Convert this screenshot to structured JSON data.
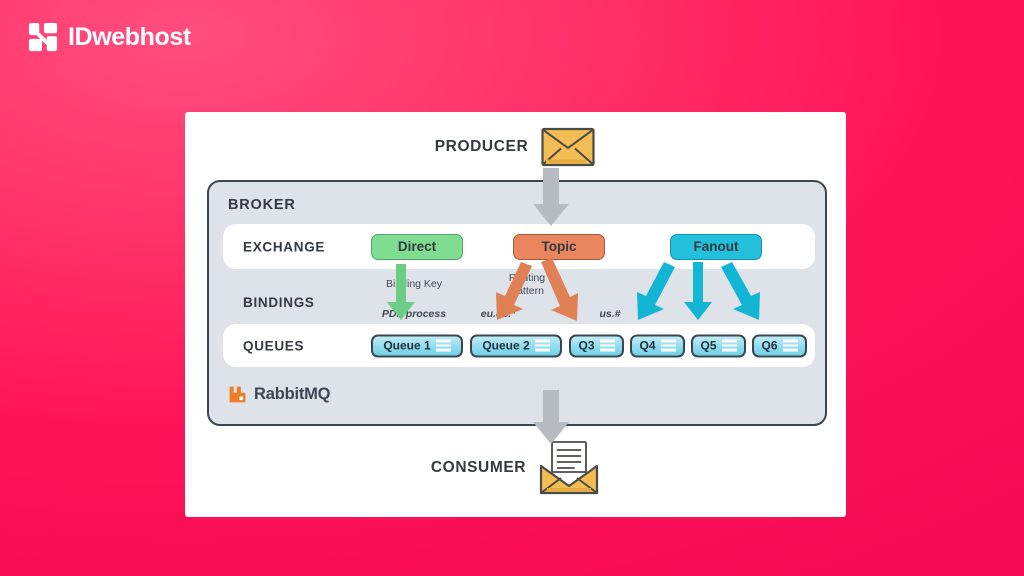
{
  "brand": {
    "name": "IDwebhost",
    "logo_icon": "idwebhost-block-mark",
    "color": "#ffffff"
  },
  "background": {
    "gradient_from": "#ff4d7e",
    "gradient_to": "#f50b55"
  },
  "diagram": {
    "producer": {
      "label": "PRODUCER",
      "icon": "closed-envelope-icon"
    },
    "broker": {
      "title": "BROKER",
      "panel_color": "#dee3e9",
      "border_color": "#3c4650"
    },
    "exchange": {
      "label": "EXCHANGE",
      "items": [
        {
          "label": "Direct",
          "color": "#7fdd92",
          "border": "#4fa663"
        },
        {
          "label": "Topic",
          "color": "#e9865d",
          "border": "#a85a3c"
        },
        {
          "label": "Fanout",
          "color": "#23c0db",
          "border": "#1891ab"
        }
      ]
    },
    "bindings": {
      "label": "BINDINGS",
      "binding_key_title": "Binding Key",
      "binding_key_value": "PDF process",
      "routing_pattern_title": "Routing\nPattern",
      "routing_pattern_left": "eu.de.*",
      "routing_pattern_right": "us.#"
    },
    "queues": {
      "label": "QUEUES",
      "items": [
        {
          "label": "Queue 1"
        },
        {
          "label": "Queue 2"
        },
        {
          "label": "Q3"
        },
        {
          "label": "Q4"
        },
        {
          "label": "Q5"
        },
        {
          "label": "Q6"
        }
      ]
    },
    "rabbitmq": {
      "label": "RabbitMQ",
      "icon": "rabbitmq-logo-icon",
      "color": "#f07d28"
    },
    "consumer": {
      "label": "CONSUMER",
      "icon": "open-envelope-with-letter-icon"
    },
    "arrow_colors": {
      "producer_to_broker": "#b7bcc2",
      "direct": "#6ccb84",
      "topic": "#e08055",
      "fanout": "#13b5d4",
      "broker_to_consumer": "#b7bcc2"
    }
  }
}
